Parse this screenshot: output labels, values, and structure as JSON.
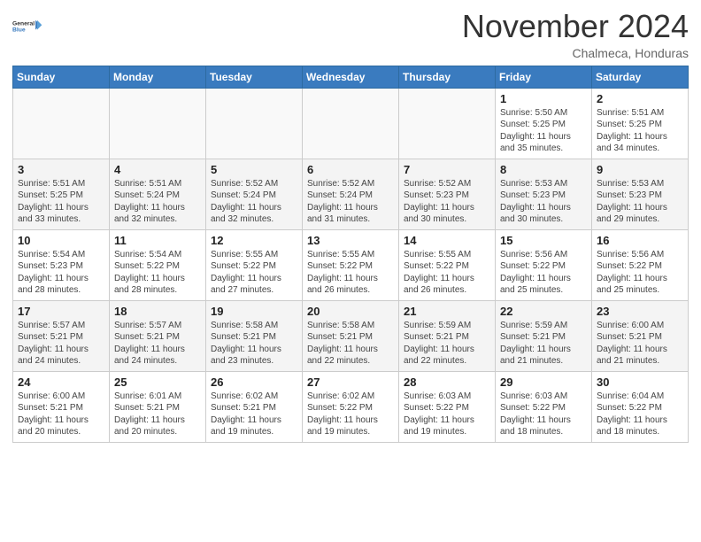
{
  "header": {
    "logo_line1": "General",
    "logo_line2": "Blue",
    "month_title": "November 2024",
    "location": "Chalmeca, Honduras"
  },
  "weekdays": [
    "Sunday",
    "Monday",
    "Tuesday",
    "Wednesday",
    "Thursday",
    "Friday",
    "Saturday"
  ],
  "weeks": [
    [
      {
        "day": "",
        "info": ""
      },
      {
        "day": "",
        "info": ""
      },
      {
        "day": "",
        "info": ""
      },
      {
        "day": "",
        "info": ""
      },
      {
        "day": "",
        "info": ""
      },
      {
        "day": "1",
        "info": "Sunrise: 5:50 AM\nSunset: 5:25 PM\nDaylight: 11 hours\nand 35 minutes."
      },
      {
        "day": "2",
        "info": "Sunrise: 5:51 AM\nSunset: 5:25 PM\nDaylight: 11 hours\nand 34 minutes."
      }
    ],
    [
      {
        "day": "3",
        "info": "Sunrise: 5:51 AM\nSunset: 5:25 PM\nDaylight: 11 hours\nand 33 minutes."
      },
      {
        "day": "4",
        "info": "Sunrise: 5:51 AM\nSunset: 5:24 PM\nDaylight: 11 hours\nand 32 minutes."
      },
      {
        "day": "5",
        "info": "Sunrise: 5:52 AM\nSunset: 5:24 PM\nDaylight: 11 hours\nand 32 minutes."
      },
      {
        "day": "6",
        "info": "Sunrise: 5:52 AM\nSunset: 5:24 PM\nDaylight: 11 hours\nand 31 minutes."
      },
      {
        "day": "7",
        "info": "Sunrise: 5:52 AM\nSunset: 5:23 PM\nDaylight: 11 hours\nand 30 minutes."
      },
      {
        "day": "8",
        "info": "Sunrise: 5:53 AM\nSunset: 5:23 PM\nDaylight: 11 hours\nand 30 minutes."
      },
      {
        "day": "9",
        "info": "Sunrise: 5:53 AM\nSunset: 5:23 PM\nDaylight: 11 hours\nand 29 minutes."
      }
    ],
    [
      {
        "day": "10",
        "info": "Sunrise: 5:54 AM\nSunset: 5:23 PM\nDaylight: 11 hours\nand 28 minutes."
      },
      {
        "day": "11",
        "info": "Sunrise: 5:54 AM\nSunset: 5:22 PM\nDaylight: 11 hours\nand 28 minutes."
      },
      {
        "day": "12",
        "info": "Sunrise: 5:55 AM\nSunset: 5:22 PM\nDaylight: 11 hours\nand 27 minutes."
      },
      {
        "day": "13",
        "info": "Sunrise: 5:55 AM\nSunset: 5:22 PM\nDaylight: 11 hours\nand 26 minutes."
      },
      {
        "day": "14",
        "info": "Sunrise: 5:55 AM\nSunset: 5:22 PM\nDaylight: 11 hours\nand 26 minutes."
      },
      {
        "day": "15",
        "info": "Sunrise: 5:56 AM\nSunset: 5:22 PM\nDaylight: 11 hours\nand 25 minutes."
      },
      {
        "day": "16",
        "info": "Sunrise: 5:56 AM\nSunset: 5:22 PM\nDaylight: 11 hours\nand 25 minutes."
      }
    ],
    [
      {
        "day": "17",
        "info": "Sunrise: 5:57 AM\nSunset: 5:21 PM\nDaylight: 11 hours\nand 24 minutes."
      },
      {
        "day": "18",
        "info": "Sunrise: 5:57 AM\nSunset: 5:21 PM\nDaylight: 11 hours\nand 24 minutes."
      },
      {
        "day": "19",
        "info": "Sunrise: 5:58 AM\nSunset: 5:21 PM\nDaylight: 11 hours\nand 23 minutes."
      },
      {
        "day": "20",
        "info": "Sunrise: 5:58 AM\nSunset: 5:21 PM\nDaylight: 11 hours\nand 22 minutes."
      },
      {
        "day": "21",
        "info": "Sunrise: 5:59 AM\nSunset: 5:21 PM\nDaylight: 11 hours\nand 22 minutes."
      },
      {
        "day": "22",
        "info": "Sunrise: 5:59 AM\nSunset: 5:21 PM\nDaylight: 11 hours\nand 21 minutes."
      },
      {
        "day": "23",
        "info": "Sunrise: 6:00 AM\nSunset: 5:21 PM\nDaylight: 11 hours\nand 21 minutes."
      }
    ],
    [
      {
        "day": "24",
        "info": "Sunrise: 6:00 AM\nSunset: 5:21 PM\nDaylight: 11 hours\nand 20 minutes."
      },
      {
        "day": "25",
        "info": "Sunrise: 6:01 AM\nSunset: 5:21 PM\nDaylight: 11 hours\nand 20 minutes."
      },
      {
        "day": "26",
        "info": "Sunrise: 6:02 AM\nSunset: 5:21 PM\nDaylight: 11 hours\nand 19 minutes."
      },
      {
        "day": "27",
        "info": "Sunrise: 6:02 AM\nSunset: 5:22 PM\nDaylight: 11 hours\nand 19 minutes."
      },
      {
        "day": "28",
        "info": "Sunrise: 6:03 AM\nSunset: 5:22 PM\nDaylight: 11 hours\nand 19 minutes."
      },
      {
        "day": "29",
        "info": "Sunrise: 6:03 AM\nSunset: 5:22 PM\nDaylight: 11 hours\nand 18 minutes."
      },
      {
        "day": "30",
        "info": "Sunrise: 6:04 AM\nSunset: 5:22 PM\nDaylight: 11 hours\nand 18 minutes."
      }
    ]
  ]
}
